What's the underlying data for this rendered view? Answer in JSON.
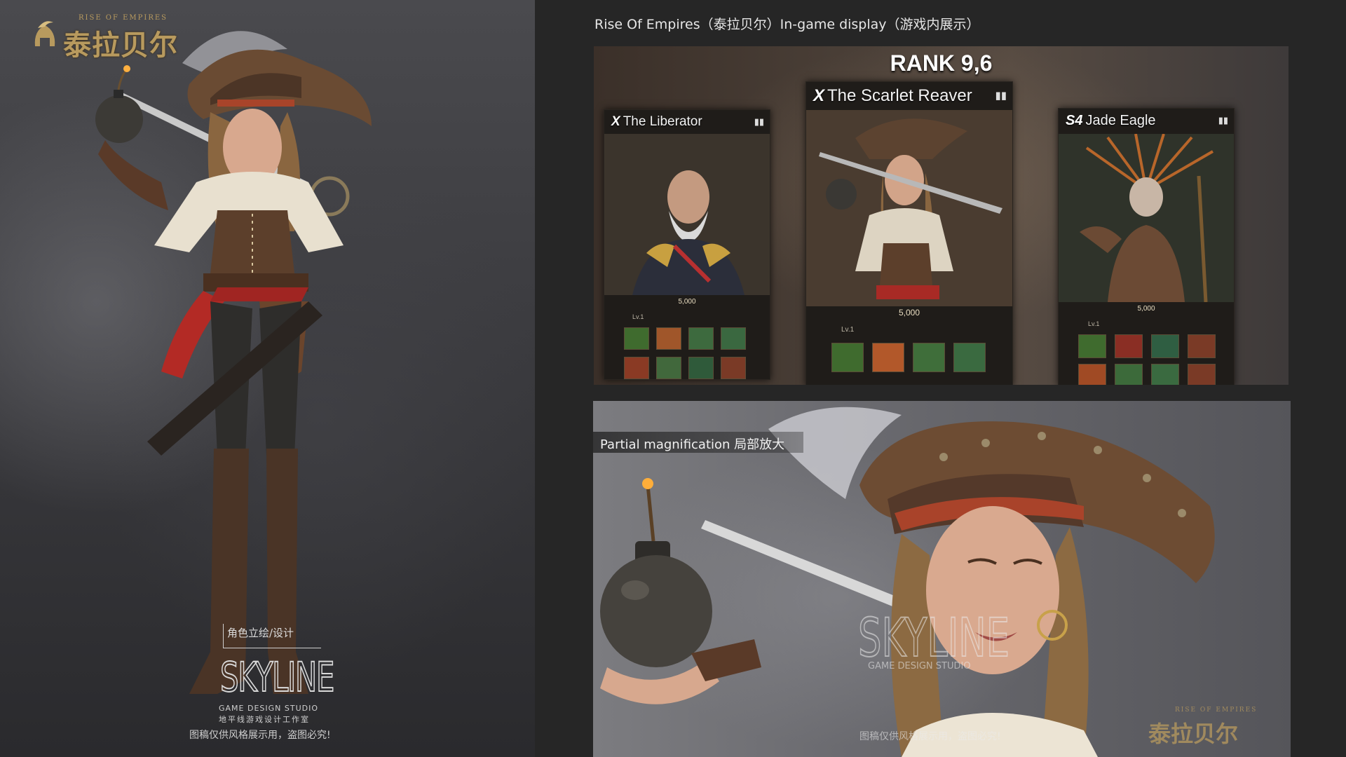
{
  "left": {
    "logo": {
      "cn": "泰拉贝尔",
      "en": "RISE OF EMPIRES"
    },
    "credit": {
      "role": "角色立绘/设计",
      "studio_mark": "SKYLINE",
      "studio_en": "GAME DESIGN STUDIO",
      "studio_cn": "地平线游戏设计工作室"
    },
    "notice": "图稿仅供风格展示用，盗图必究!"
  },
  "right": {
    "title": "Rise Of Empires（泰拉贝尔）In-game display（游戏内展示）",
    "ingame": {
      "rank": "RANK 9,6",
      "cards": [
        {
          "rank_letter": "X",
          "name": "The Liberator",
          "cost": "5,000",
          "level": "Lv.1"
        },
        {
          "rank_letter": "X",
          "name": "The Scarlet Reaver",
          "cost": "5,000",
          "level": "Lv.1"
        },
        {
          "rank_letter": "S4",
          "name": "Jade Eagle",
          "cost": "5,000",
          "level": "Lv.1"
        }
      ]
    },
    "magnification": {
      "label": "Partial magnification  局部放大",
      "studio_mark": "SKYLINE",
      "studio_en": "GAME DESIGN STUDIO",
      "notice": "图稿仅供风格展示用，盗图必究!",
      "logo_cn": "泰拉贝尔",
      "logo_en": "RISE OF EMPIRES"
    }
  },
  "icons": [
    "helmet-logo-icon",
    "book-icon",
    "bomb-icon",
    "skill-icon"
  ],
  "colors": {
    "accent_gold": "#b89a5e",
    "background": "#262626"
  }
}
